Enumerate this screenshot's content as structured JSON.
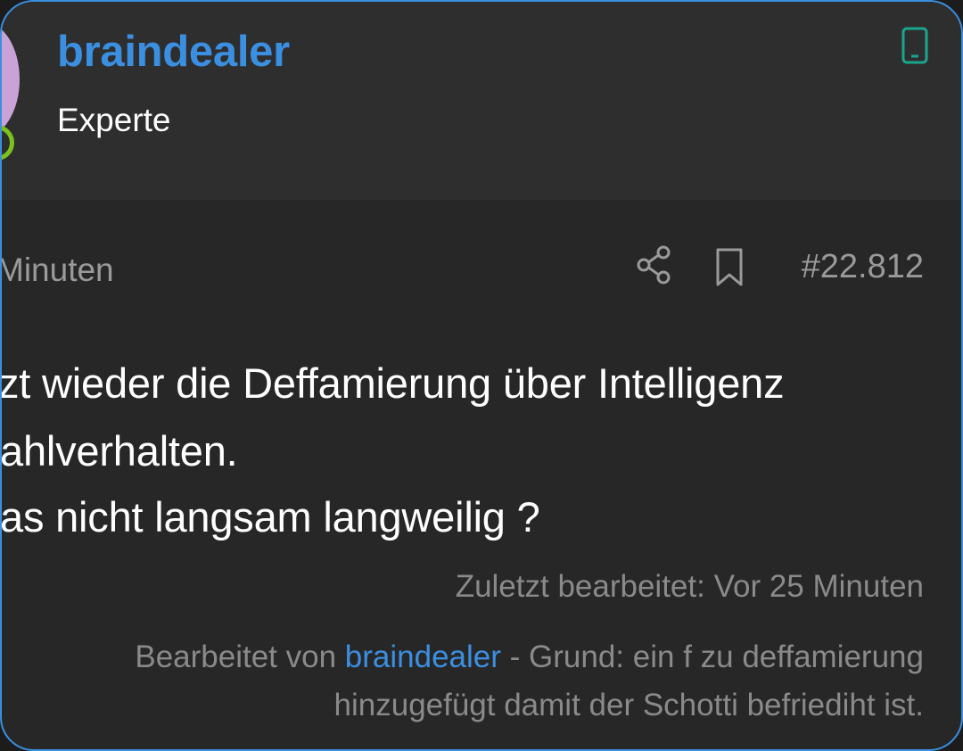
{
  "author": {
    "username": "braindealer",
    "role": "Experte",
    "online": true,
    "avatar_color": "#c9a2d8",
    "device_icon": "mobile-phone-icon"
  },
  "post": {
    "time_fragment": "Minuten",
    "number": "#22.812",
    "body_lines": [
      "zt wieder die Deffamierung über Intelligenz",
      "ahlverhalten.",
      "as nicht langsam langweilig ?"
    ],
    "last_edited": "Zuletzt bearbeitet: Vor 25 Minuten",
    "edit_note": {
      "prefix": "Bearbeitet von",
      "editor": "braindealer",
      "reason": "- Grund: ein f zu deffamierung hinzugefügt damit der Schotti befriediht ist."
    }
  },
  "colors": {
    "accent": "#3b8fe0",
    "online": "#7bc21b",
    "device": "#1aa68e"
  }
}
